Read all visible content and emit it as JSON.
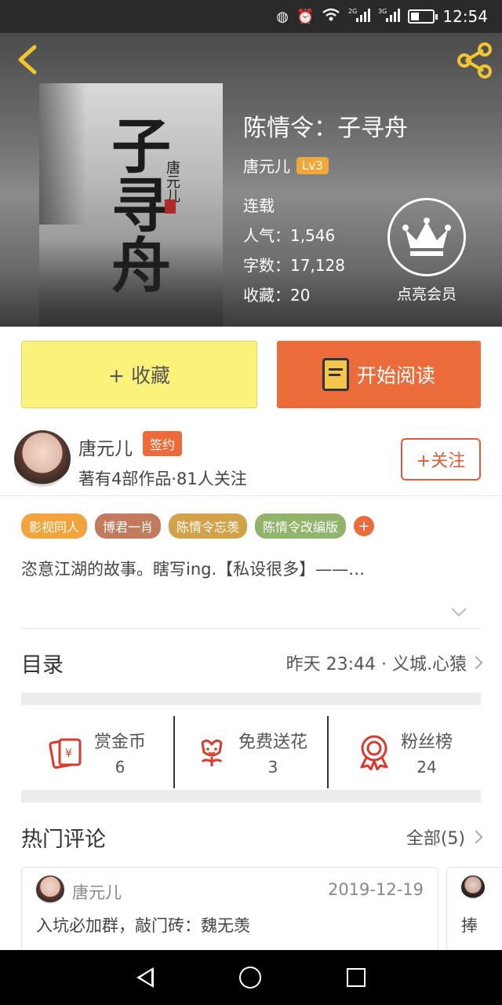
{
  "status_bar": {
    "time": "12:54",
    "net1": "2G",
    "net2": "3G"
  },
  "book": {
    "title": "陈情令：子寻舟",
    "author": "唐元儿",
    "level": "Lv3",
    "status": "连载",
    "popularity": "人气：1,546",
    "words": "字数：17,128",
    "favorites": "收藏：20",
    "cover_title": "子寻舟",
    "cover_author": "唐元儿"
  },
  "vip": {
    "label": "点亮会员"
  },
  "buttons": {
    "favorite": "+ 收藏",
    "read": "开始阅读"
  },
  "writer": {
    "name": "唐元儿",
    "badge": "签约",
    "sub": "著有4部作品·81人关注",
    "follow": "+关注"
  },
  "tags": [
    "影视同人",
    "博君一肖",
    "陈情令忘羡",
    "陈情令改编版"
  ],
  "tag_add": "+",
  "intro": "恣意江湖的故事。瞎写ing.【私设很多】——…",
  "toc": {
    "title": "目录",
    "latest": "昨天 23:44 · 义城.心猿"
  },
  "actions": [
    {
      "label": "赏金币",
      "value": "6",
      "icon": "red-envelope-icon"
    },
    {
      "label": "免费送花",
      "value": "3",
      "icon": "flower-icon"
    },
    {
      "label": "粉丝榜",
      "value": "24",
      "icon": "medal-icon"
    }
  ],
  "hot": {
    "title": "热门评论",
    "all": "全部(5)"
  },
  "comments": [
    {
      "name": "唐元儿",
      "date": "2019-12-19",
      "text": "入坑必加群，敲门砖：魏无羡"
    },
    {
      "name": "",
      "date": "",
      "text": "捧"
    }
  ],
  "colors": {
    "accent": "#ec6b3b",
    "favorite_bg": "#fbf27c",
    "level_badge": "#f0a83a",
    "icon_red": "#d93a2b"
  }
}
